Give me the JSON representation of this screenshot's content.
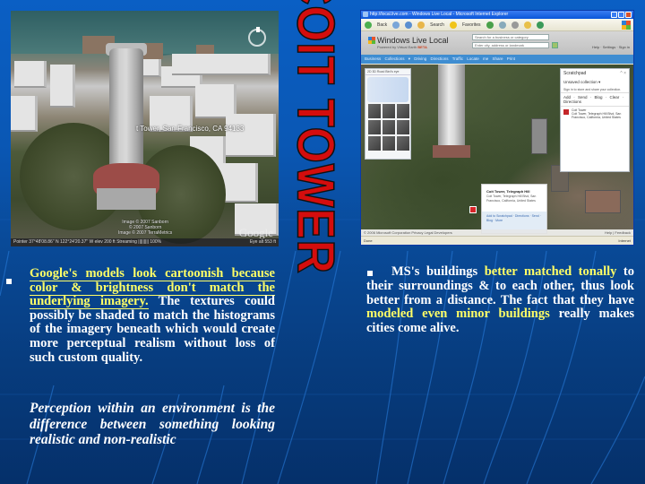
{
  "slide": {
    "title": "COIT TOWER",
    "colors": {
      "background": "#0a57b4",
      "title_fill": "#d40d0d",
      "highlight": "#ffff66",
      "body_text": "#ffffff"
    }
  },
  "google_earth": {
    "place_label": "t Tower, San Francisco, CA 94133",
    "credits": [
      "Image © 2007 Sanborn",
      "© 2007 Sanborn",
      "Image © 2007 TerraMetrics"
    ],
    "logo": "Google",
    "status_left": "Pointer  37°48'08.86\" N    122°24'20.37\" W  elev  200 ft   Streaming ||||||||| 100%",
    "status_right": "Eye alt  553 ft"
  },
  "ie_window": {
    "title": "http://local.live.com - Windows Live Local - Microsoft Internet Explorer",
    "toolbar_items": [
      "Back",
      "Search",
      "Favorites"
    ],
    "brand": "Windows Live Local",
    "brand_sub": "Powered by Virtual Earth",
    "brand_beta": "BETA",
    "search_business_placeholder": "Search for a business or category",
    "search_location_placeholder": "Enter city, address or landmark",
    "header_links": "Help · Settings · Sign in",
    "nav_items": "Business  Collections ▾  Driving  Directions  Traffic  Locate me  Share  Print",
    "left_panel_tabs": "2D   3D   Road   Bird's eye",
    "scratchpad": {
      "title": "Scratchpad",
      "close": "^ ×",
      "collection": "Unsaved collection ▾",
      "hint": "Sign in to store and share your collection.",
      "actions": "Add · Send · Blog · Clear · Directions",
      "item_title": "Coit Tower",
      "item_address": "Coit Tower, Telegraph Hill Blvd, San Francisco, California, United States"
    },
    "popup": {
      "title": "Coit Tower, Telegraph Hill",
      "address": "Coit Tower, Telegraph Hill Blvd, San Francisco, California, United States",
      "links": "Add to Scratchpad · Directions · Send · Blog · More"
    },
    "map_footer_left": "© 2006 Microsoft Corporation   Privacy  Legal  Developers",
    "map_footer_right": "Help | Feedback",
    "status_left": "Done",
    "status_right": "Internet"
  },
  "left_bullet": {
    "highlighted": "Google's models look cartoonish because color & brightness don't match the underlying imagery.",
    "rest": " The textures could possibly be shaded to match the histograms of the imagery beneath which would create more perceptual realism without loss of such custom quality."
  },
  "left_italic": "Perception within an environment is the difference between something looking realistic and non-realistic",
  "right_bullet": {
    "part1": "MS's buildings ",
    "hl1": "better matched tonally",
    "part2": " to their surroundings & to each other, thus look better from a distance. The fact that they have ",
    "hl2": "modeled even minor buildings",
    "part3": " really makes cities come alive."
  }
}
